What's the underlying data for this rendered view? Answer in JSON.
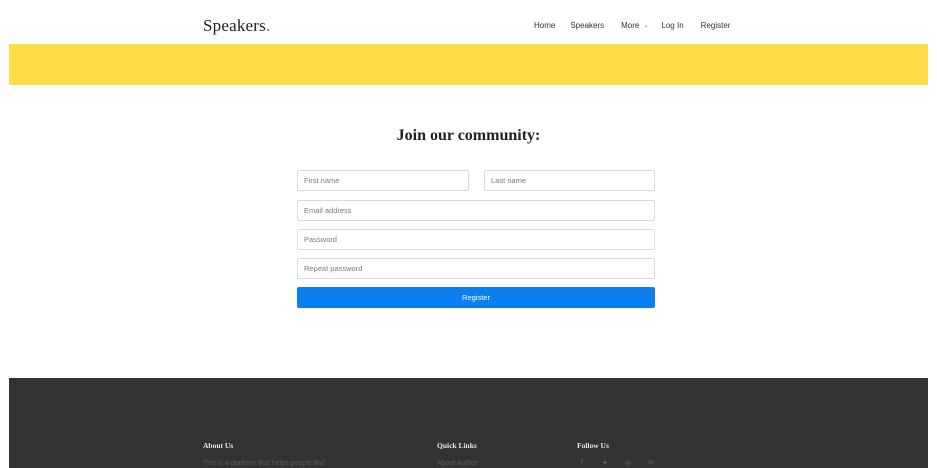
{
  "header": {
    "brand": "Speakers",
    "brand_dot": ".",
    "nav": {
      "home": "Home",
      "speakers": "Speakers",
      "more": "More",
      "login": "Log In",
      "register": "Register"
    }
  },
  "form": {
    "title": "Join our community:",
    "first_name_placeholder": "First name",
    "last_name_placeholder": "Last name",
    "email_placeholder": "Email address",
    "password_placeholder": "Password",
    "repeat_password_placeholder": "Repeat password",
    "submit_label": "Register"
  },
  "footer": {
    "about_heading": "About Us",
    "about_text": "This is a platform that helps people find",
    "quick_heading": "Quick Links",
    "quick_link_1": "About Author",
    "follow_heading": "Follow Us",
    "social_icons": [
      "facebook-icon",
      "twitter-icon",
      "instagram-icon",
      "linkedin-icon"
    ]
  },
  "colors": {
    "banner": "#fddc47",
    "accent": "#0a7ff2",
    "footer_bg": "#333333"
  }
}
